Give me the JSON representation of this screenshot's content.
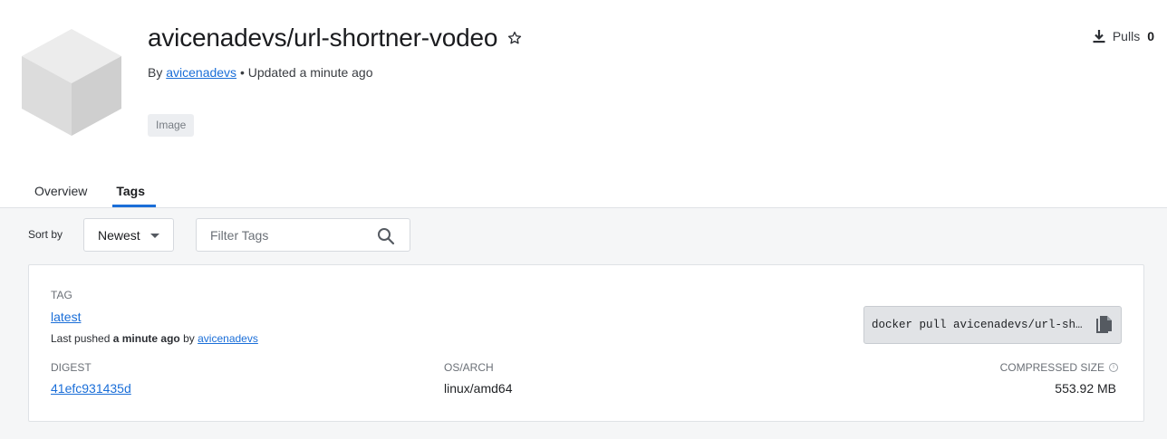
{
  "repo": {
    "name": "avicenadevs/url-shortner-vodeo",
    "by_prefix": "By",
    "author": "avicenadevs",
    "updated": "• Updated a minute ago",
    "badge": "Image",
    "pulls_label": "Pulls",
    "pulls_count": "0"
  },
  "tabs": [
    {
      "label": "Overview",
      "active": false
    },
    {
      "label": "Tags",
      "active": true
    }
  ],
  "toolbar": {
    "sort_label": "Sort by",
    "sort_value": "Newest",
    "filter_placeholder": "Filter Tags"
  },
  "tag_card": {
    "tag_header": "TAG",
    "tag_name": "latest",
    "pushed_prefix": "Last pushed",
    "pushed_when": "a minute ago",
    "pushed_by_prefix": "by",
    "pushed_by": "avicenadevs",
    "pull_command": "docker pull avicenadevs/url-shortner-vodeo:latest",
    "digest_header": "DIGEST",
    "digest": "41efc931435d",
    "os_header": "OS/ARCH",
    "os": "linux/amd64",
    "size_header": "COMPRESSED SIZE",
    "size": "553.92 MB"
  },
  "icons": {
    "logo": "cube-icon",
    "star": "star-outline-icon",
    "download": "download-icon",
    "search": "search-icon",
    "copy": "copy-icon",
    "info": "info-icon"
  },
  "colors": {
    "link": "#1a6ed8",
    "tab_indicator": "#1a6ed8",
    "content_bg": "#f5f6f7"
  }
}
